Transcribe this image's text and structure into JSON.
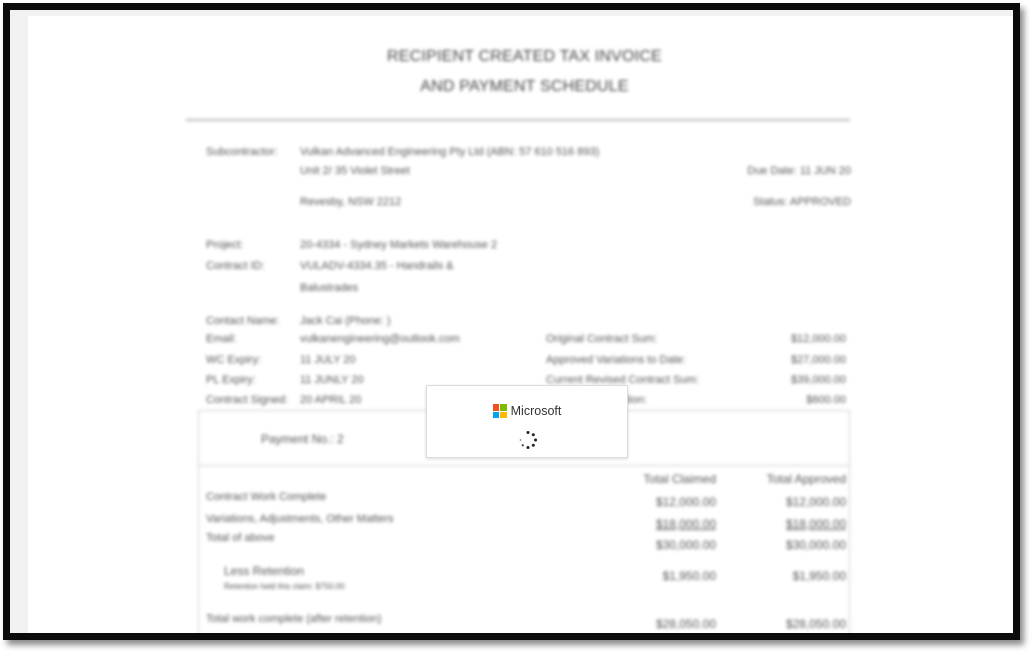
{
  "document": {
    "title_line1": "RECIPIENT CREATED TAX INVOICE",
    "title_line2": "AND PAYMENT SCHEDULE",
    "subcontractor_label": "Subcontractor:",
    "subcontractor_name": "Vulkan Advanced Engineering Pty Ltd (ABN: 57 610 516 893)",
    "address_line1": "Unit 2/ 35 Violet Street",
    "address_line2": "Revesby, NSW 2212",
    "due_date": "Due Date: 11 JUN 20",
    "status": "Status: APPROVED",
    "project_label": "Project:",
    "project_value": "20-4334 - Sydney Markets Warehouse 2",
    "contract_id_label": "Contract ID:",
    "contract_id_value_1": "VULADV-4334.35 - Handrails &",
    "contract_id_value_2": "Balustrades",
    "contact_name_label": "Contact Name:",
    "contact_name_value": "Jack Cai (Phone: )",
    "email_label": "Email:",
    "email_value": "vulkanengineering@outlook.com",
    "wc_label": "WC Expiry:",
    "wc_value": "11 JULY 20",
    "pl_label": "PL Expiry:",
    "pl_value": "11 JUNLY 20",
    "signed_label": "Contract Signed:",
    "signed_value": "20 APRIL 20",
    "ocs_label": "Original Contract Sum:",
    "ocs_value": "$12,000.00",
    "avd_label": "Approved Variations to Date:",
    "avd_value": "$27,000.00",
    "crcs_label": "Current Revised Contract Sum:",
    "crcs_value": "$39,000.00",
    "ret_label": "Maximum Retention:",
    "ret_value": "$600.00",
    "payment_no": "Payment No.: 2",
    "col_claimed": "Total Claimed",
    "col_approved": "Total Approved",
    "rows": [
      {
        "label": "Contract Work Complete",
        "claimed": "$12,000.00",
        "approved": "$12,000.00"
      },
      {
        "label": "Variations, Adjustments, Other Matters",
        "claimed": "$18,000.00",
        "approved": "$18,000.00"
      },
      {
        "label": "Total of above",
        "claimed": "$30,000.00",
        "approved": "$30,000.00"
      },
      {
        "label": "Less Retention",
        "claimed": "$1,950.00",
        "approved": "$1,950.00"
      },
      {
        "label": "Total work complete (after retention)",
        "claimed": "$28,050.00",
        "approved": "$28,050.00"
      }
    ],
    "retention_note": "Retention held this claim: $750.00"
  },
  "loading_dialog": {
    "brand": "Microsoft",
    "logo_colors": [
      "#f25022",
      "#7fba00",
      "#00a4ef",
      "#ffb900"
    ]
  }
}
